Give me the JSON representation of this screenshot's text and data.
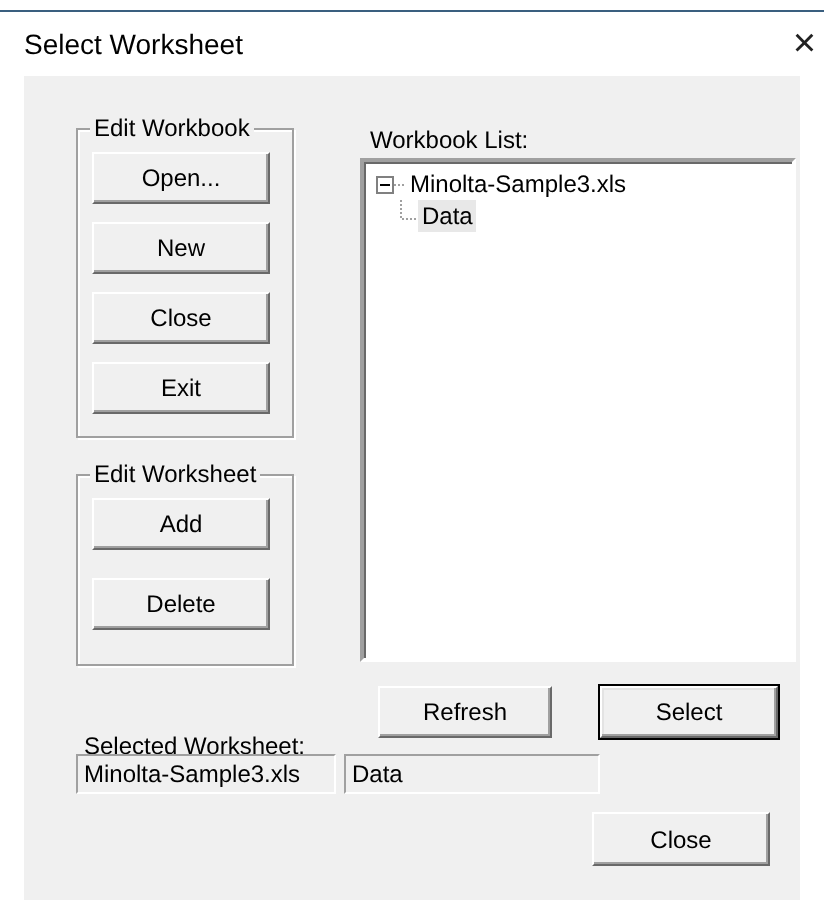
{
  "window": {
    "title": "Select Worksheet",
    "close": "×"
  },
  "edit_workbook": {
    "title": "Edit Workbook",
    "buttons": [
      "Open...",
      "New",
      "Close",
      "Exit"
    ]
  },
  "edit_worksheet": {
    "title": "Edit Worksheet",
    "buttons": [
      "Add",
      "Delete"
    ]
  },
  "workbook_list": {
    "label": "Workbook List:",
    "items": [
      {
        "label": "Minolta-Sample3.xls",
        "expanded": true,
        "selected": false,
        "children": [
          {
            "label": "Data",
            "selected": true
          }
        ]
      }
    ]
  },
  "actions": [
    {
      "label": "Refresh",
      "default": false
    },
    {
      "label": "Select",
      "default": true
    }
  ],
  "selected_worksheet": {
    "label": "Selected Worksheet:",
    "workbook": "Minolta-Sample3.xls",
    "worksheet": "Data"
  },
  "close_button": {
    "label": "Close",
    "default": false
  }
}
